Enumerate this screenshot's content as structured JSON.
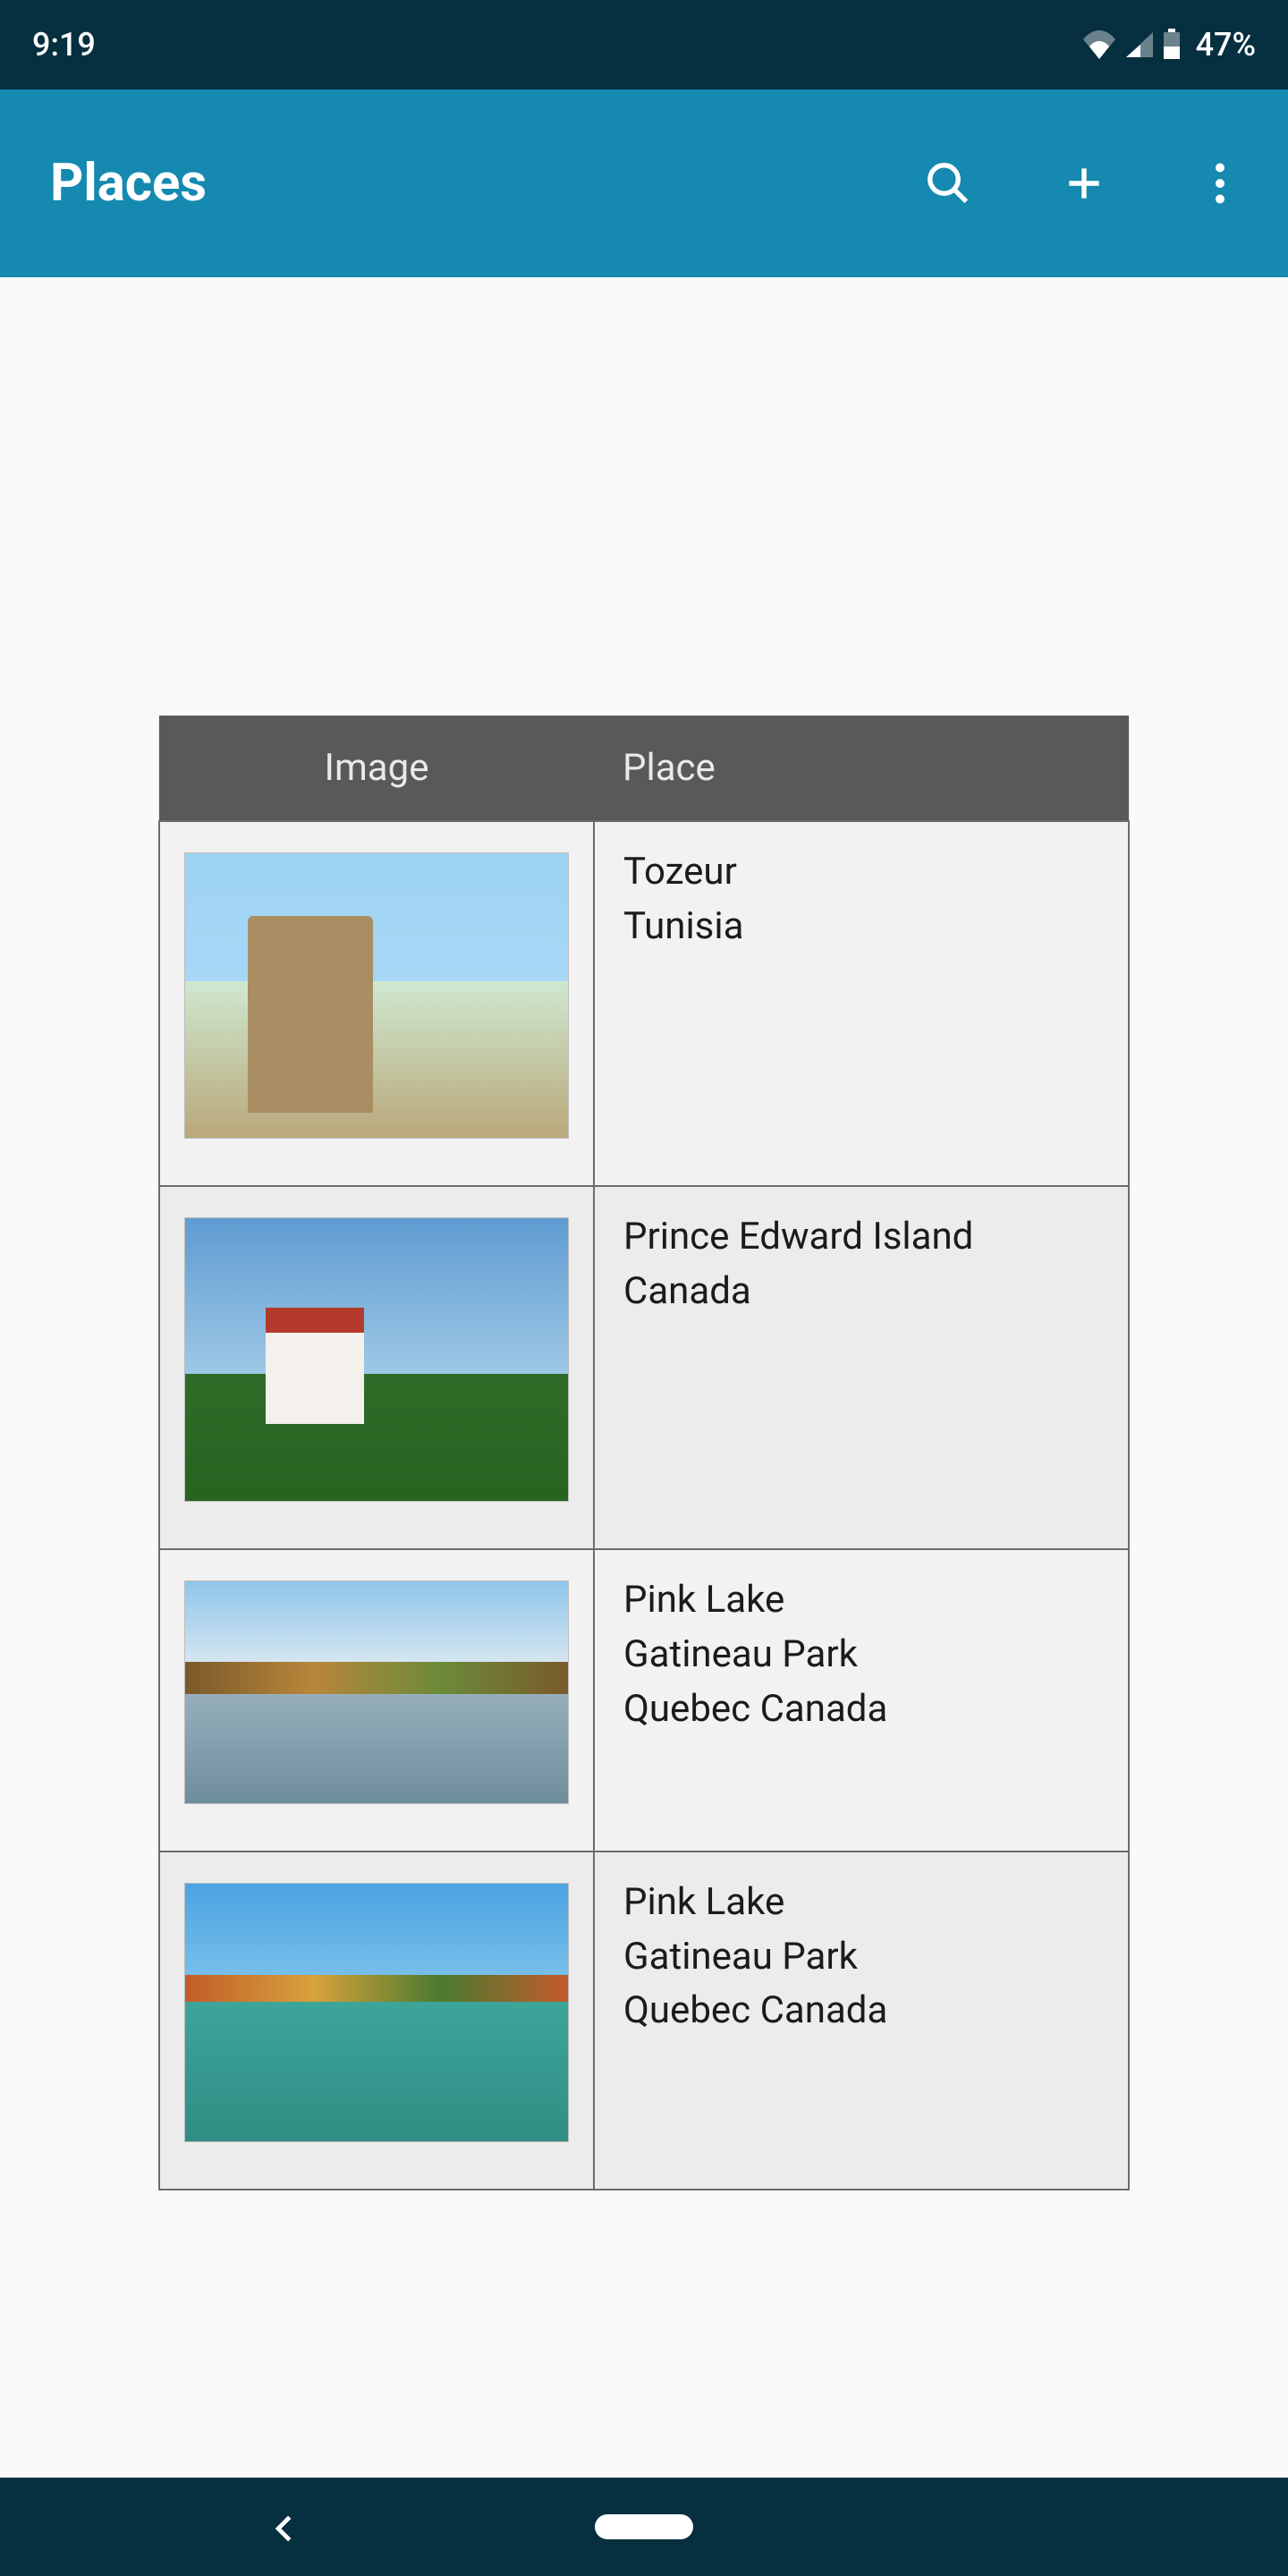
{
  "status": {
    "time": "9:19",
    "battery_text": "47%"
  },
  "appbar": {
    "title": "Places"
  },
  "table": {
    "headers": [
      "Image",
      "Place"
    ],
    "rows": [
      {
        "place_lines": [
          "Tozeur",
          "Tunisia"
        ]
      },
      {
        "place_lines": [
          "Prince Edward Island",
          "Canada"
        ]
      },
      {
        "place_lines": [
          "Pink Lake",
          "Gatineau Park",
          "Quebec Canada"
        ]
      },
      {
        "place_lines": [
          "Pink Lake",
          "Gatineau Park",
          "Quebec Canada"
        ]
      }
    ]
  }
}
